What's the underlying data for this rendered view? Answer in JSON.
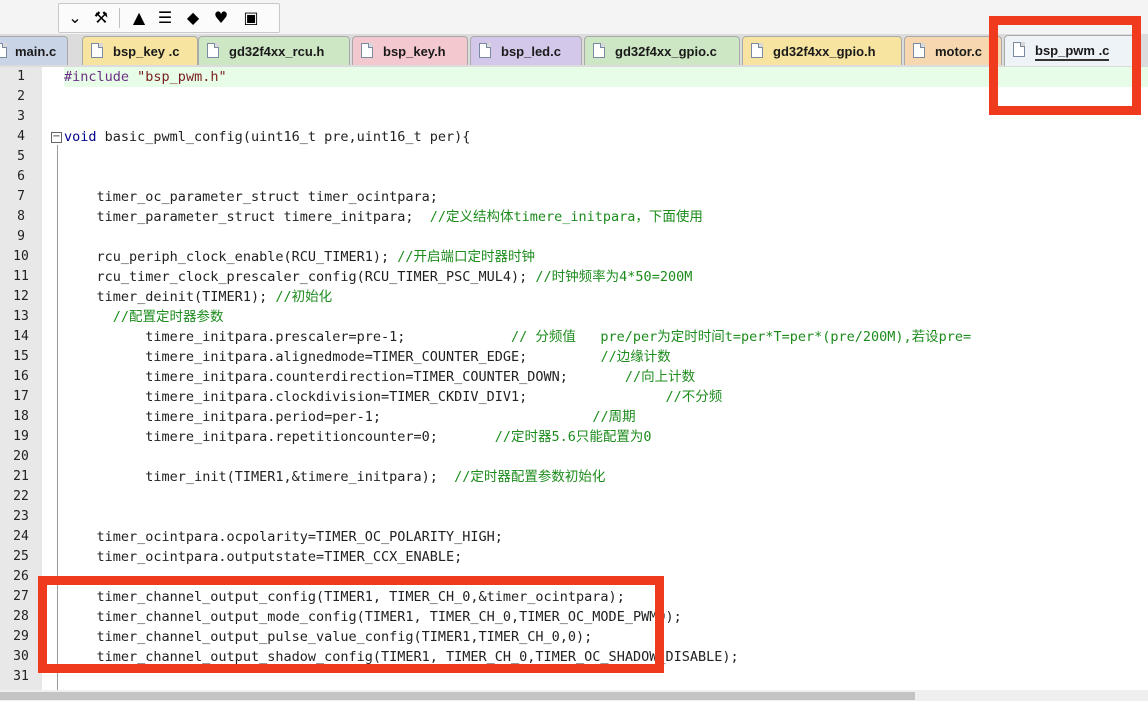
{
  "toolbar": {
    "buttons": [
      {
        "name": "dropdown-icon",
        "glyph": "⌄"
      },
      {
        "name": "magic-wand-icon",
        "glyph": "⚒"
      },
      {
        "name": "load-icon",
        "glyph": "▲"
      },
      {
        "name": "layers-icon",
        "glyph": "☰"
      },
      {
        "name": "diamond-icon",
        "glyph": "◆"
      },
      {
        "name": "heart-icon",
        "glyph": "♥"
      },
      {
        "name": "package-icon",
        "glyph": "▣"
      }
    ]
  },
  "tabs": [
    {
      "label": "main.c",
      "color": "#c9d4e6",
      "active": false
    },
    {
      "label": "bsp_key .c",
      "color": "#f6e4a0",
      "active": false
    },
    {
      "label": "gd32f4xx_rcu.h",
      "color": "#cde6c4",
      "active": false
    },
    {
      "label": "bsp_key.h",
      "color": "#f3c8cf",
      "active": false
    },
    {
      "label": "bsp_led.c",
      "color": "#d4c8ea",
      "active": false
    },
    {
      "label": "gd32f4xx_gpio.c",
      "color": "#cde6c4",
      "active": false
    },
    {
      "label": "gd32f4xx_gpio.h",
      "color": "#f6e4a0",
      "active": false
    },
    {
      "label": "motor.c",
      "color": "#f6d7b0",
      "active": false
    },
    {
      "label": "bsp_pwm .c",
      "color": "#eef3f8",
      "active": true
    }
  ],
  "code_lines": [
    {
      "n": "1",
      "indent": 0,
      "hl": true,
      "segs": [
        {
          "t": "#include",
          "c": "pp"
        },
        {
          "t": " ",
          "c": ""
        },
        {
          "t": "\"bsp_pwm.h\"",
          "c": "str"
        }
      ]
    },
    {
      "n": "2",
      "indent": 0,
      "segs": []
    },
    {
      "n": "3",
      "indent": 0,
      "segs": []
    },
    {
      "n": "4",
      "indent": 0,
      "segs": [
        {
          "t": "void",
          "c": "kw"
        },
        {
          "t": " basic_pwml_config(uint16_t pre,uint16_t per){",
          "c": ""
        }
      ]
    },
    {
      "n": "5",
      "indent": 0,
      "segs": []
    },
    {
      "n": "6",
      "indent": 0,
      "segs": []
    },
    {
      "n": "7",
      "indent": 2,
      "segs": [
        {
          "t": "timer_oc_parameter_struct timer_ocintpara;",
          "c": ""
        }
      ]
    },
    {
      "n": "8",
      "indent": 2,
      "segs": [
        {
          "t": "timer_parameter_struct timere_initpara;  ",
          "c": ""
        },
        {
          "t": "//定义结构体timere_initpara，下面使用",
          "c": "cm"
        }
      ]
    },
    {
      "n": "9",
      "indent": 0,
      "segs": []
    },
    {
      "n": "10",
      "indent": 2,
      "segs": [
        {
          "t": "rcu_periph_clock_enable(RCU_TIMER1); ",
          "c": ""
        },
        {
          "t": "//开启端口定时器时钟",
          "c": "cm"
        }
      ]
    },
    {
      "n": "11",
      "indent": 2,
      "segs": [
        {
          "t": "rcu_timer_clock_prescaler_config(RCU_TIMER_PSC_MUL4); ",
          "c": ""
        },
        {
          "t": "//时钟频率为4*50=200M",
          "c": "cm"
        }
      ]
    },
    {
      "n": "12",
      "indent": 2,
      "segs": [
        {
          "t": "timer_deinit(TIMER1); ",
          "c": ""
        },
        {
          "t": "//初始化",
          "c": "cm"
        }
      ]
    },
    {
      "n": "13",
      "indent": 3,
      "segs": [
        {
          "t": "//配置定时器参数",
          "c": "cm"
        }
      ]
    },
    {
      "n": "14",
      "indent": 5,
      "segs": [
        {
          "t": "timere_initpara.prescaler=pre-1;             ",
          "c": ""
        },
        {
          "t": "// 分频值   pre/per为定时时间t=per*T=per*(pre/200M),若设pre=",
          "c": "cm"
        }
      ]
    },
    {
      "n": "15",
      "indent": 5,
      "segs": [
        {
          "t": "timere_initpara.alignedmode=TIMER_COUNTER_EDGE;         ",
          "c": ""
        },
        {
          "t": "//边缘计数",
          "c": "cm"
        }
      ]
    },
    {
      "n": "16",
      "indent": 5,
      "segs": [
        {
          "t": "timere_initpara.counterdirection=TIMER_COUNTER_DOWN;       ",
          "c": ""
        },
        {
          "t": "//向上计数",
          "c": "cm"
        }
      ]
    },
    {
      "n": "17",
      "indent": 5,
      "segs": [
        {
          "t": "timere_initpara.clockdivision=TIMER_CKDIV_DIV1;                 ",
          "c": ""
        },
        {
          "t": "//不分频",
          "c": "cm"
        }
      ]
    },
    {
      "n": "18",
      "indent": 5,
      "segs": [
        {
          "t": "timere_initpara.period=per-1;                          ",
          "c": ""
        },
        {
          "t": "//周期",
          "c": "cm"
        }
      ]
    },
    {
      "n": "19",
      "indent": 5,
      "segs": [
        {
          "t": "timere_initpara.repetitioncounter=0;       ",
          "c": ""
        },
        {
          "t": "//定时器5.6只能配置为0",
          "c": "cm"
        }
      ]
    },
    {
      "n": "20",
      "indent": 0,
      "segs": []
    },
    {
      "n": "21",
      "indent": 5,
      "segs": [
        {
          "t": "timer_init(TIMER1,&timere_initpara);  ",
          "c": ""
        },
        {
          "t": "//定时器配置参数初始化",
          "c": "cm"
        }
      ]
    },
    {
      "n": "22",
      "indent": 0,
      "segs": []
    },
    {
      "n": "23",
      "indent": 0,
      "segs": []
    },
    {
      "n": "24",
      "indent": 2,
      "segs": [
        {
          "t": "timer_ocintpara.ocpolarity=TIMER_OC_POLARITY_HIGH;",
          "c": ""
        }
      ]
    },
    {
      "n": "25",
      "indent": 2,
      "segs": [
        {
          "t": "timer_ocintpara.outputstate=TIMER_CCX_ENABLE;",
          "c": ""
        }
      ]
    },
    {
      "n": "26",
      "indent": 0,
      "segs": []
    },
    {
      "n": "27",
      "indent": 2,
      "segs": [
        {
          "t": "timer_channel_output_config(TIMER1, TIMER_CH_0,&timer_ocintpara);",
          "c": ""
        }
      ]
    },
    {
      "n": "28",
      "indent": 2,
      "segs": [
        {
          "t": "timer_channel_output_mode_config(TIMER1, TIMER_CH_0,TIMER_OC_MODE_PWM0);",
          "c": ""
        }
      ]
    },
    {
      "n": "29",
      "indent": 2,
      "segs": [
        {
          "t": "timer_channel_output_pulse_value_config(TIMER1,TIMER_CH_0,0);",
          "c": ""
        }
      ]
    },
    {
      "n": "30",
      "indent": 2,
      "segs": [
        {
          "t": "timer_channel_output_shadow_config(TIMER1, TIMER_CH_0,TIMER_OC_SHADOW_DISABLE);",
          "c": ""
        }
      ]
    },
    {
      "n": "31",
      "indent": 0,
      "segs": []
    }
  ],
  "colors": {
    "highlight_box": "#f03a1e",
    "active_line": "#e8fde8",
    "comment": "#1d8c1d"
  }
}
